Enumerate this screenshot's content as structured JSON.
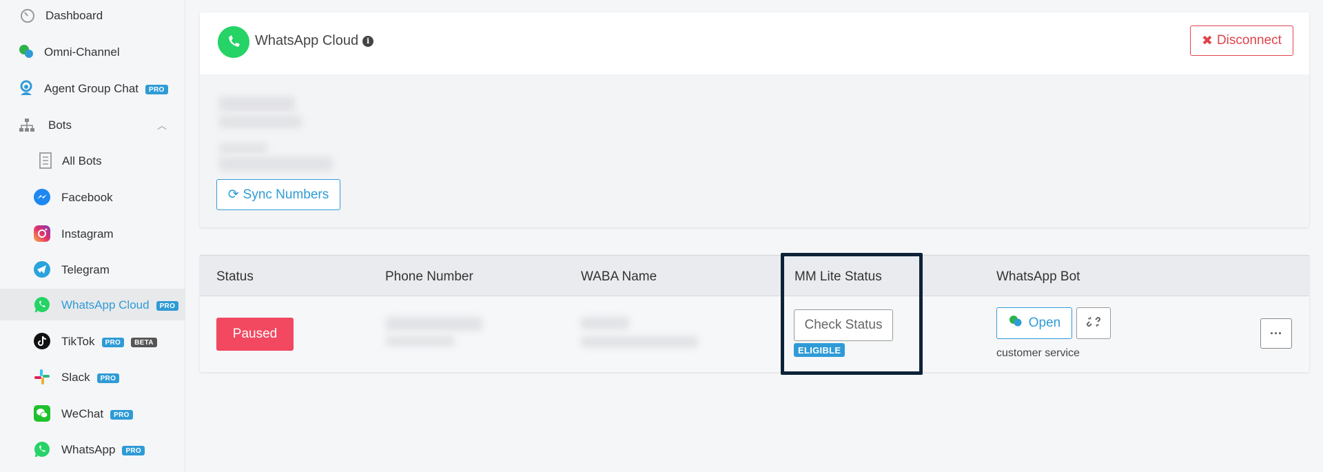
{
  "sidebar": {
    "items": [
      {
        "label": "Dashboard",
        "icon": "gauge-icon"
      },
      {
        "label": "Omni-Channel",
        "icon": "chat-bubbles-icon"
      },
      {
        "label": "Agent Group Chat",
        "badge": "PRO",
        "icon": "headset-icon"
      },
      {
        "label": "Bots",
        "icon": "sitemap-icon"
      },
      {
        "label": "All Bots",
        "icon": "document-icon"
      },
      {
        "label": "Facebook",
        "icon": "messenger-icon"
      },
      {
        "label": "Instagram",
        "icon": "instagram-icon"
      },
      {
        "label": "Telegram",
        "icon": "telegram-icon"
      },
      {
        "label": "WhatsApp Cloud",
        "badge": "PRO",
        "icon": "whatsapp-icon",
        "active": true
      },
      {
        "label": "TikTok",
        "badge": "PRO",
        "badge2": "BETA",
        "icon": "tiktok-icon"
      },
      {
        "label": "Slack",
        "badge": "PRO",
        "icon": "slack-icon"
      },
      {
        "label": "WeChat",
        "badge": "PRO",
        "icon": "wechat-icon"
      },
      {
        "label": "WhatsApp",
        "badge": "PRO",
        "icon": "whatsapp-icon"
      }
    ]
  },
  "card": {
    "title": "WhatsApp Cloud",
    "disconnect_label": "Disconnect",
    "sync_label": "Sync Numbers"
  },
  "table": {
    "headers": [
      "Status",
      "Phone Number",
      "WABA Name",
      "MM Lite Status",
      "WhatsApp Bot"
    ],
    "row": {
      "status": "Paused",
      "check_status_label": "Check Status",
      "mm_lite_badge": "ELIGIBLE",
      "open_label": "Open",
      "bot_name": "customer service",
      "more_label": "···"
    }
  },
  "colors": {
    "accent": "#2f9bd6",
    "danger": "#e0434b",
    "paused": "#f24860",
    "whatsapp": "#25d366",
    "highlight": "#0d2237"
  }
}
